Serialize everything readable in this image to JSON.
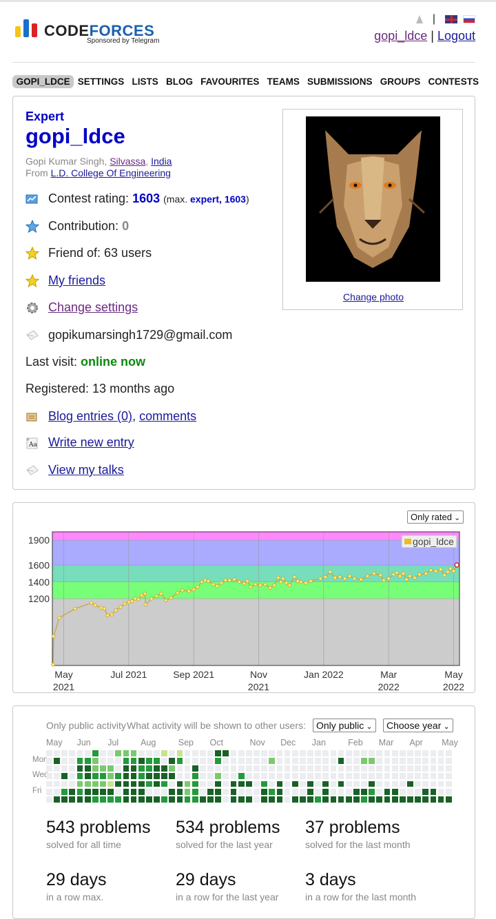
{
  "brand": {
    "name_part1": "CODE",
    "name_part2": "FORCES",
    "sponsor": "Sponsored by Telegram",
    "colors": [
      "#f5c518",
      "#1a70c8",
      "#d22"
    ]
  },
  "header": {
    "user_link": "gopi_ldce",
    "separator": "|",
    "logout": "Logout",
    "lang_icons": [
      "uk-flag-icon",
      "ru-flag-icon"
    ]
  },
  "menu": [
    "GOPI_LDCE",
    "SETTINGS",
    "LISTS",
    "BLOG",
    "FAVOURITES",
    "TEAMS",
    "SUBMISSIONS",
    "GROUPS",
    "CONTESTS"
  ],
  "profile": {
    "rank": "Expert",
    "handle": "gopi_ldce",
    "name_prefix": "Gopi Kumar Singh,",
    "city": "Silvassa",
    "country": "India",
    "from_prefix": "From",
    "organization": "L.D. College Of Engineering",
    "rating_label": "Contest rating:",
    "rating": "1603",
    "max_prefix": "(max.",
    "max_value": "expert, 1603",
    "max_suffix": ")",
    "contribution_label": "Contribution:",
    "contribution": "0",
    "friend_of": "Friend of: 63 users",
    "my_friends": "My friends",
    "change_settings": "Change settings",
    "email": "gopikumarsingh1729@gmail.com",
    "last_visit_label": "Last visit:",
    "last_visit": "online now",
    "registered": "Registered: 13 months ago",
    "blog_entries": "Blog entries (0)",
    "comments": "comments",
    "write_entry": "Write new entry",
    "view_talks": "View my talks",
    "change_photo": "Change photo"
  },
  "rating_graph": {
    "filter": "Only rated",
    "legend": "gopi_ldce"
  },
  "chart_data": {
    "type": "line",
    "series": [
      {
        "name": "gopi_ldce",
        "color": "#eebb22"
      }
    ],
    "y_ticks": [
      1200,
      1400,
      1600,
      1900
    ],
    "ylim": [
      400,
      2000
    ],
    "x_ticks": [
      {
        "label1": "May",
        "label2": "2021"
      },
      {
        "label1": "Jul 2021",
        "label2": ""
      },
      {
        "label1": "Sep 2021",
        "label2": ""
      },
      {
        "label1": "Nov",
        "label2": "2021"
      },
      {
        "label1": "Jan 2022",
        "label2": ""
      },
      {
        "label1": "Mar",
        "label2": "2022"
      },
      {
        "label1": "May",
        "label2": "2022"
      }
    ],
    "x_tick_months": [
      1.0,
      3.0,
      5.0,
      7.0,
      9.0,
      11.0,
      13.0
    ],
    "xlim": [
      0.65,
      13.18
    ],
    "bands": [
      {
        "from": 400,
        "to": 1200,
        "color": "#cccccc"
      },
      {
        "from": 1200,
        "to": 1400,
        "color": "#77ff77"
      },
      {
        "from": 1400,
        "to": 1600,
        "color": "#77ddbb"
      },
      {
        "from": 1600,
        "to": 1900,
        "color": "#aaaaff"
      },
      {
        "from": 1900,
        "to": 2000,
        "color": "#ff88ff"
      }
    ],
    "points": [
      [
        0.67,
        410
      ],
      [
        0.69,
        750
      ],
      [
        0.86,
        970
      ],
      [
        1.35,
        1080
      ],
      [
        1.85,
        1150
      ],
      [
        1.97,
        1120
      ],
      [
        2.15,
        1090
      ],
      [
        2.25,
        1080
      ],
      [
        2.35,
        1000
      ],
      [
        2.48,
        1010
      ],
      [
        2.6,
        1060
      ],
      [
        2.75,
        1100
      ],
      [
        2.88,
        1140
      ],
      [
        3.0,
        1160
      ],
      [
        3.1,
        1170
      ],
      [
        3.2,
        1200
      ],
      [
        3.3,
        1190
      ],
      [
        3.4,
        1240
      ],
      [
        3.5,
        1260
      ],
      [
        3.52,
        1130
      ],
      [
        3.7,
        1200
      ],
      [
        3.86,
        1230
      ],
      [
        4.0,
        1260
      ],
      [
        4.15,
        1180
      ],
      [
        4.3,
        1210
      ],
      [
        4.5,
        1270
      ],
      [
        4.65,
        1300
      ],
      [
        4.85,
        1290
      ],
      [
        5.0,
        1310
      ],
      [
        5.12,
        1340
      ],
      [
        5.25,
        1400
      ],
      [
        5.35,
        1420
      ],
      [
        5.45,
        1410
      ],
      [
        5.6,
        1370
      ],
      [
        5.72,
        1350
      ],
      [
        5.85,
        1390
      ],
      [
        5.98,
        1420
      ],
      [
        6.1,
        1420
      ],
      [
        6.25,
        1430
      ],
      [
        6.4,
        1400
      ],
      [
        6.55,
        1380
      ],
      [
        6.65,
        1410
      ],
      [
        6.75,
        1340
      ],
      [
        6.9,
        1370
      ],
      [
        7.05,
        1360
      ],
      [
        7.2,
        1370
      ],
      [
        7.35,
        1330
      ],
      [
        7.48,
        1360
      ],
      [
        7.6,
        1450
      ],
      [
        7.68,
        1400
      ],
      [
        7.75,
        1440
      ],
      [
        7.85,
        1390
      ],
      [
        7.95,
        1360
      ],
      [
        8.1,
        1460
      ],
      [
        8.2,
        1410
      ],
      [
        8.3,
        1400
      ],
      [
        8.45,
        1390
      ],
      [
        8.6,
        1410
      ],
      [
        8.9,
        1440
      ],
      [
        9.05,
        1460
      ],
      [
        9.2,
        1520
      ],
      [
        9.35,
        1450
      ],
      [
        9.5,
        1460
      ],
      [
        9.65,
        1440
      ],
      [
        9.8,
        1470
      ],
      [
        9.95,
        1440
      ],
      [
        10.15,
        1430
      ],
      [
        10.35,
        1470
      ],
      [
        10.55,
        1500
      ],
      [
        10.75,
        1480
      ],
      [
        10.85,
        1420
      ],
      [
        11.0,
        1440
      ],
      [
        11.15,
        1490
      ],
      [
        11.25,
        1510
      ],
      [
        11.35,
        1470
      ],
      [
        11.45,
        1500
      ],
      [
        11.55,
        1430
      ],
      [
        11.65,
        1470
      ],
      [
        11.8,
        1450
      ],
      [
        11.95,
        1490
      ],
      [
        12.15,
        1500
      ],
      [
        12.3,
        1540
      ],
      [
        12.45,
        1530
      ],
      [
        12.6,
        1550
      ],
      [
        12.72,
        1480
      ],
      [
        12.82,
        1520
      ],
      [
        12.9,
        1560
      ],
      [
        13.0,
        1530
      ],
      [
        13.1,
        1603
      ]
    ]
  },
  "activity": {
    "public_label": "Only public activity",
    "shown_label": "What activity will be shown to other users:",
    "shown_select": "Only public",
    "year_select": "Choose year",
    "months": [
      "May",
      "Jun",
      "Jul",
      "Aug",
      "Sep",
      "Oct",
      "Nov",
      "Dec",
      "Jan",
      "Feb",
      "Mar",
      "Apr",
      "May"
    ],
    "days": [
      "Mon",
      "Wed",
      "Fri"
    ],
    "weeks": 53,
    "levels": [
      "#ebedf0",
      "#c6e48b",
      "#7bc96f",
      "#239a3b",
      "#196127"
    ],
    "grid": [
      "0000003002220001010000440000000000000000000000000000000",
      "0400332000334330430000300000020000000040022000000000000",
      "0000442220443344200400000000000000000000000000000000000",
      "0040343323443444400300200300000000000000000000000000000",
      "0000222214444343042300404440304040404040004000040000000",
      "0034344440444000442304404000434000404000443044000440000",
      "0444443333444443443344404440444044434444434444444444444"
    ]
  },
  "stats": [
    {
      "value": "543 problems",
      "label": "solved for all time"
    },
    {
      "value": "534 problems",
      "label": "solved for the last year"
    },
    {
      "value": "37 problems",
      "label": "solved for the last month"
    },
    {
      "value": "29 days",
      "label": "in a row max."
    },
    {
      "value": "29 days",
      "label": "in a row for the last year"
    },
    {
      "value": "3 days",
      "label": "in a row for the last month"
    }
  ]
}
